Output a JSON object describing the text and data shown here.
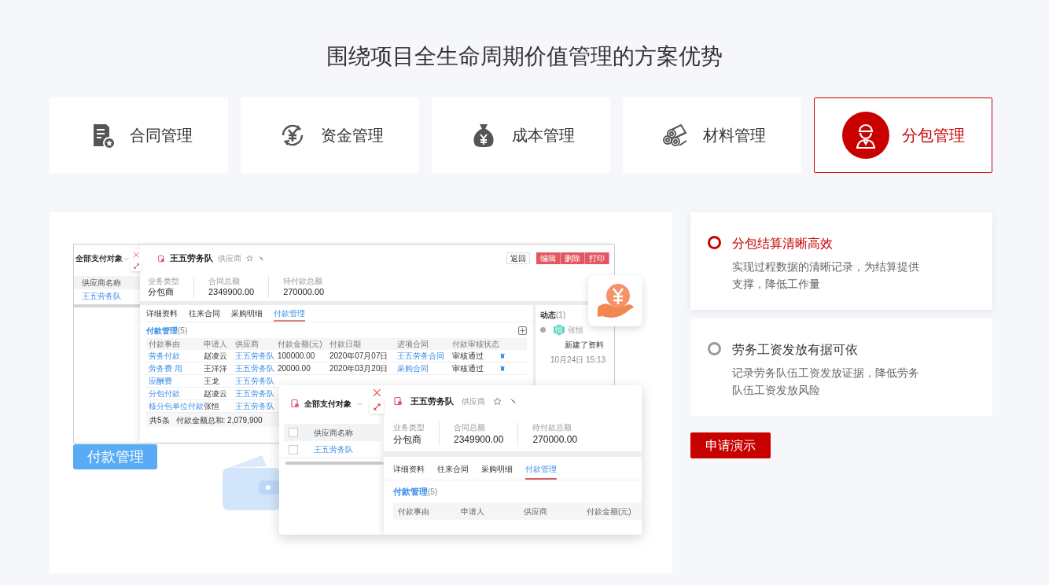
{
  "title": "围绕项目全生命周期价值管理的方案优势",
  "modules": [
    {
      "label": "合同管理",
      "kind": "document",
      "selected": false
    },
    {
      "label": "资金管理",
      "kind": "yuan-cycle",
      "selected": false
    },
    {
      "label": "成本管理",
      "kind": "money-bag",
      "selected": false
    },
    {
      "label": "材料管理",
      "kind": "pipes",
      "selected": false
    },
    {
      "label": "分包管理",
      "kind": "worker",
      "selected": true
    }
  ],
  "showcase": {
    "caption": "付款管理",
    "back_window": {
      "filter": "全部支付对象",
      "list_header": "供应商名称",
      "list_rows": [
        "王五劳务队"
      ],
      "name": "王五劳务队",
      "tag": "供应商",
      "buttons": [
        {
          "label": "返回",
          "kind": "outline"
        },
        {
          "label": "编辑",
          "kind": "primary"
        },
        {
          "label": "删除",
          "kind": "primary"
        },
        {
          "label": "打印",
          "kind": "primary"
        }
      ],
      "stats": [
        {
          "label": "业务类型",
          "value": "分包商"
        },
        {
          "label": "合同总额",
          "value": "2349900.00"
        },
        {
          "label": "待付款总额",
          "value": "270000.00"
        }
      ],
      "tabs": [
        {
          "label": "详细资料",
          "selected": false
        },
        {
          "label": "往来合同",
          "selected": false
        },
        {
          "label": "采购明细",
          "selected": false
        },
        {
          "label": "付款管理",
          "selected": true
        }
      ],
      "section_title": "付款管理",
      "section_count": "(5)",
      "columns": [
        {
          "label": "付款事由",
          "link": true
        },
        {
          "label": "申请人",
          "link": false
        },
        {
          "label": "供应商",
          "link": true
        },
        {
          "label": "付款金额(元)",
          "link": false
        },
        {
          "label": "付款日期",
          "link": false
        },
        {
          "label": "进项合同",
          "link": true
        },
        {
          "label": "付款审核状态",
          "link": false
        }
      ],
      "rows": [
        [
          "劳务付款",
          "赵凌云",
          "王五劳务队",
          "100000.00",
          "2020年07月07日",
          "王五劳务合同",
          "审核通过"
        ],
        [
          "劳务费 用",
          "王洋洋",
          "王五劳务队",
          "20000.00",
          "2020年03月20日",
          "采购合同",
          "审核通过"
        ],
        [
          "应酬费",
          "王龙",
          "王五劳务队"
        ],
        [
          "分包付款",
          "赵凌云",
          "王五劳务队"
        ],
        [
          "核分包单位付款",
          "张恒",
          "王五劳务队"
        ]
      ],
      "footer_count": "共5条",
      "footer_total": "付款金额总和: 2,079,900",
      "activity": {
        "title": "动态",
        "count": "(1)",
        "avatar": "恒",
        "user": "张恒",
        "action": "新建了资料",
        "time": "10月24日 15:13"
      }
    },
    "front_window": {
      "filter": "全部支付对象",
      "list_header": "供应商名称",
      "header_checked": false,
      "list_rows": [
        {
          "label": "王五劳务队",
          "checked": false
        }
      ],
      "name": "王五劳务队",
      "tag": "供应商",
      "stats": [
        {
          "label": "业务类型",
          "value": "分包商"
        },
        {
          "label": "合同总额",
          "value": "2349900.00"
        },
        {
          "label": "待付款总额",
          "value": "270000.00"
        }
      ],
      "tabs": [
        {
          "label": "详细资料",
          "selected": false
        },
        {
          "label": "往来合同",
          "selected": false
        },
        {
          "label": "采购明细",
          "selected": false
        },
        {
          "label": "付款管理",
          "selected": true
        }
      ],
      "section_title": "付款管理",
      "section_count": "(5)",
      "columns": [
        "付款事由",
        "申请人",
        "供应商",
        "付款金额(元)"
      ]
    }
  },
  "features": [
    {
      "title": "分包结算清晰高效",
      "description": "实现过程数据的清晰记录，为结算提供支撑，降低工作量",
      "selected": true
    },
    {
      "title": "劳务工资发放有据可依",
      "description": "记录劳务队伍工资发放证据，降低劳务队伍工资发放风险",
      "selected": false
    }
  ],
  "demo_button": "申请演示"
}
